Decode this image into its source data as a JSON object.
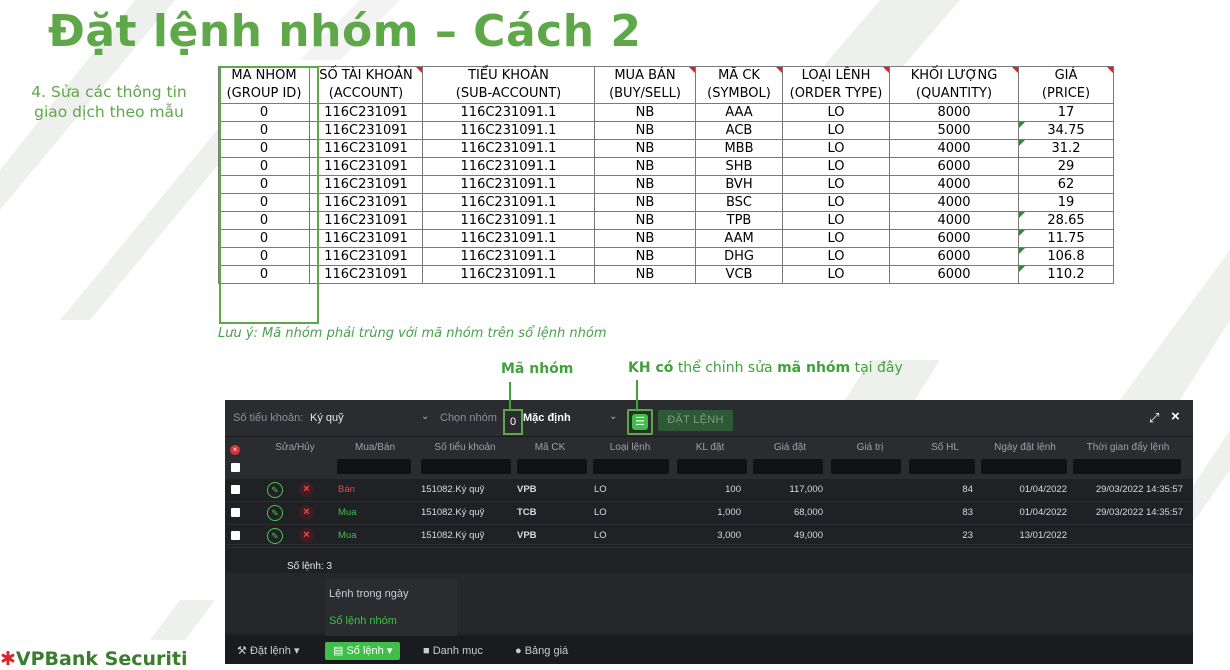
{
  "slide": {
    "title": "Đặt lệnh nhóm – Cách 2",
    "side_note": "4. Sửa các thông tin giao dịch theo mẫu",
    "note": "Lưu ý: Mã nhóm phải trùng với mã nhóm trên sổ lệnh nhóm",
    "annotation_group": "Mã nhóm",
    "annotation_edit_prefix": "KH có",
    "annotation_edit_mid": "thể chỉnh sửa",
    "annotation_edit_bold": "mã nhóm",
    "annotation_edit_suffix": "tại đây",
    "logo": "VPBank Securiti"
  },
  "excel": {
    "headers": [
      {
        "vi": "MÃ NHÓM",
        "en": "(GROUP ID)"
      },
      {
        "vi": "SỐ TÀI KHOẢN",
        "en": "(ACCOUNT)"
      },
      {
        "vi": "TIỂU KHOẢN",
        "en": "(SUB-ACCOUNT)"
      },
      {
        "vi": "MUA BÁN",
        "en": "(BUY/SELL)"
      },
      {
        "vi": "MÃ CK",
        "en": "(SYMBOL)"
      },
      {
        "vi": "LOẠI LÊNH",
        "en": "(ORDER TYPE)"
      },
      {
        "vi": "KHỐI LƯỢNG",
        "en": "(QUANTITY)"
      },
      {
        "vi": "GIÁ",
        "en": "(PRICE)"
      }
    ],
    "rows": [
      [
        "0",
        "116C231091",
        "116C231091.1",
        "NB",
        "AAA",
        "LO",
        "8000",
        "17"
      ],
      [
        "0",
        "116C231091",
        "116C231091.1",
        "NB",
        "ACB",
        "LO",
        "5000",
        "34.75"
      ],
      [
        "0",
        "116C231091",
        "116C231091.1",
        "NB",
        "MBB",
        "LO",
        "4000",
        "31.2"
      ],
      [
        "0",
        "116C231091",
        "116C231091.1",
        "NB",
        "SHB",
        "LO",
        "6000",
        "29"
      ],
      [
        "0",
        "116C231091",
        "116C231091.1",
        "NB",
        "BVH",
        "LO",
        "4000",
        "62"
      ],
      [
        "0",
        "116C231091",
        "116C231091.1",
        "NB",
        "BSC",
        "LO",
        "4000",
        "19"
      ],
      [
        "0",
        "116C231091",
        "116C231091.1",
        "NB",
        "TPB",
        "LO",
        "4000",
        "28.65"
      ],
      [
        "0",
        "116C231091",
        "116C231091.1",
        "NB",
        "AAM",
        "LO",
        "6000",
        "11.75"
      ],
      [
        "0",
        "116C231091",
        "116C231091.1",
        "NB",
        "DHG",
        "LO",
        "6000",
        "106.8"
      ],
      [
        "0",
        "116C231091",
        "116C231091.1",
        "NB",
        "VCB",
        "LO",
        "6000",
        "110.2"
      ]
    ]
  },
  "app": {
    "toolbar": {
      "account_label": "Số tiểu khoản:",
      "account_value": "Ký quỹ",
      "group_label": "Chọn nhóm",
      "group_value": "0",
      "group_name": "Mặc định",
      "place_order": "ĐẶT LỆNH"
    },
    "columns": [
      "Sửa/Hủy",
      "Mua/Bán",
      "Số tiểu khoản",
      "Mã CK",
      "Loại lệnh",
      "KL đặt",
      "Giá đặt",
      "Giá trị",
      "Số HL",
      "Ngày đặt lệnh",
      "Thời gian đẩy lệnh"
    ],
    "orders": [
      {
        "side": "Bán",
        "account": "151082.Ký quỹ",
        "symbol": "VPB",
        "type": "LO",
        "qty": "100",
        "price": "117,000",
        "value": "",
        "shl": "84",
        "date": "01/04/2022",
        "time": "29/03/2022 14:35:57"
      },
      {
        "side": "Mua",
        "account": "151082.Ký quỹ",
        "symbol": "TCB",
        "type": "LO",
        "qty": "1,000",
        "price": "68,000",
        "value": "",
        "shl": "83",
        "date": "01/04/2022",
        "time": "29/03/2022 14:35:57"
      },
      {
        "side": "Mua",
        "account": "151082.Ký quỹ",
        "symbol": "VPB",
        "type": "LO",
        "qty": "3,000",
        "price": "49,000",
        "value": "",
        "shl": "23",
        "date": "13/01/2022",
        "time": ""
      }
    ],
    "count_label": "Số lệnh: 3",
    "menu": [
      "Lệnh trong ngày",
      "Sổ lệnh nhóm"
    ],
    "tabs": [
      "Đặt lệnh",
      "Sổ lệnh",
      "Danh mục",
      "Bảng giá"
    ]
  }
}
